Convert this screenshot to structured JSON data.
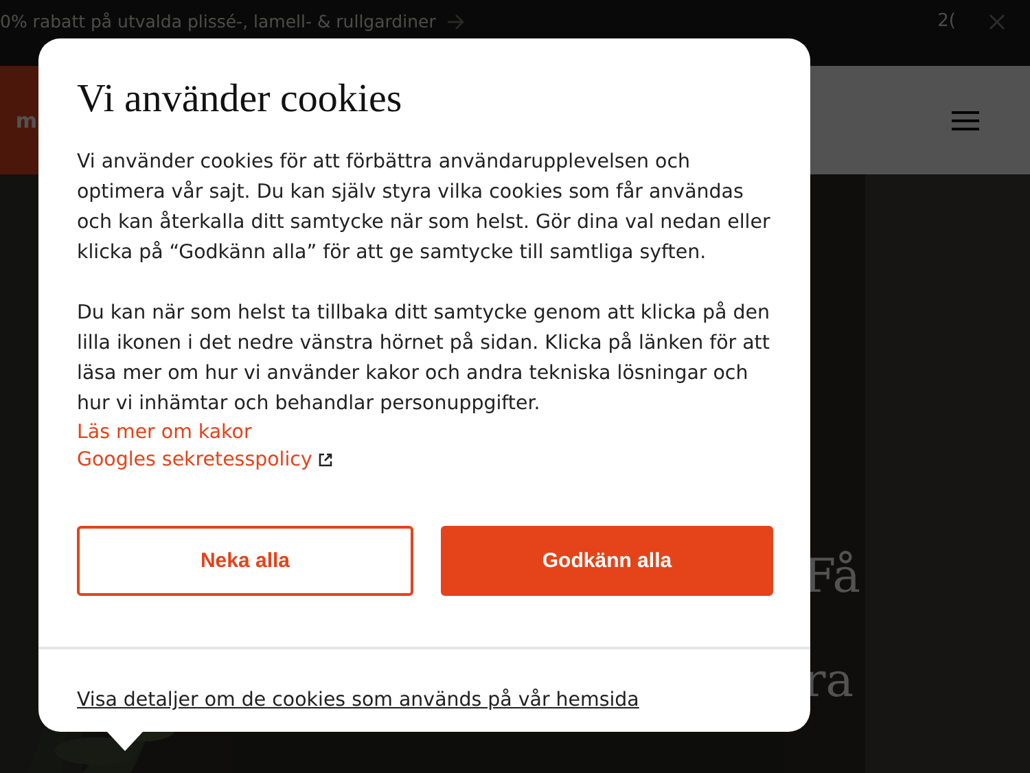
{
  "promo_bar": {
    "text": "0% rabatt på utvalda plissé-, lamell- & rullgardiner",
    "right_text": "2("
  },
  "header": {
    "logo_text": "m"
  },
  "hero": {
    "heading_lines": [
      "Få",
      "ra"
    ]
  },
  "cookie_dialog": {
    "title": "Vi använder cookies",
    "paragraphs": [
      "Vi använder cookies för att förbättra användarupplevelsen och optimera vår sajt. Du kan själv styra vilka cookies som får användas och kan återkalla ditt samtycke när som helst. Gör dina val nedan eller klicka på “Godkänn alla” för att ge samtycke till samtliga syften.",
      "Du kan när som helst ta tillbaka ditt samtycke genom att klicka på den lilla ikonen i det nedre vänstra hörnet på sidan. Klicka på länken för att läsa mer om hur vi använder kakor och andra tekniska lösningar och hur vi inhämtar och behandlar personuppgifter."
    ],
    "links": [
      {
        "text": "Läs mer om kakor",
        "external": false
      },
      {
        "text": "Googles sekretesspolicy",
        "external": true
      }
    ],
    "buttons": [
      {
        "label": "Neka alla",
        "kind": "outline"
      },
      {
        "label": "Godkänn alla",
        "kind": "filled"
      }
    ],
    "details_link": "Visa detaljer om de cookies som används på vår hemsida"
  }
}
